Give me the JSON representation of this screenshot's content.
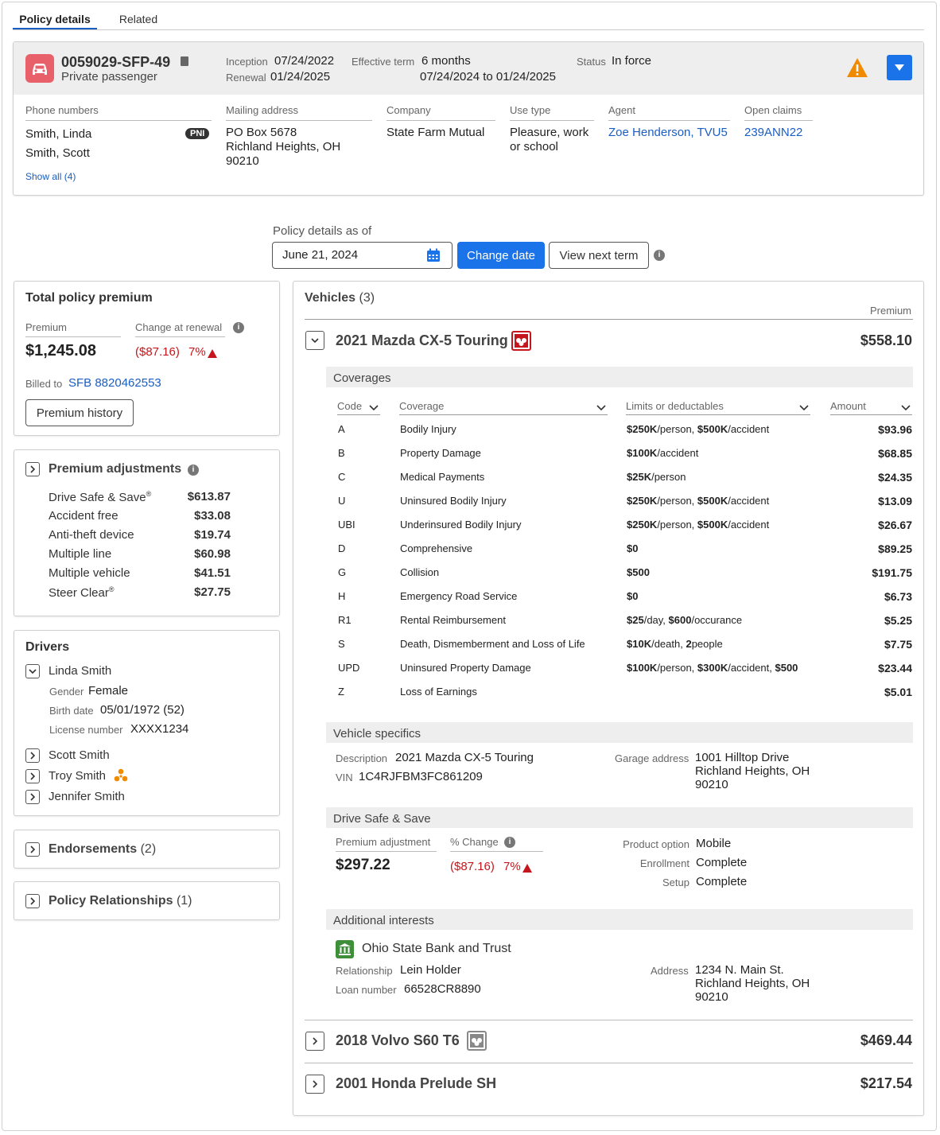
{
  "tabs": [
    {
      "label": "Policy details",
      "active": true
    },
    {
      "label": "Related",
      "active": false
    }
  ],
  "policy": {
    "number": "0059029-SFP-49",
    "type": "Private passenger",
    "inception_label": "Inception",
    "inception": "07/24/2022",
    "renewal_label": "Renewal",
    "renewal": "01/24/2025",
    "term_label": "Effective term",
    "term": "6 months",
    "term_range": "07/24/2024 to 01/24/2025",
    "status_label": "Status",
    "status": "In force"
  },
  "contacts": {
    "phone_label": "Phone numbers",
    "names": [
      "Smith, Linda",
      "Smith, Scott"
    ],
    "pni": "PNI",
    "show_all": "Show all (4)",
    "mail_label": "Mailing address",
    "mail_lines": [
      "PO Box 5678",
      "Richland Heights, OH",
      "90210"
    ],
    "company_label": "Company",
    "company": "State Farm Mutual",
    "use_label": "Use type",
    "use_lines": [
      "Pleasure, work",
      "or school"
    ],
    "agent_label": "Agent",
    "agent": "Zoe Henderson, TVU5",
    "claims_label": "Open claims",
    "claims": "239ANN22"
  },
  "asof": {
    "label": "Policy details as of",
    "date": "June 21, 2024",
    "change_btn": "Change date",
    "next_btn": "View next term"
  },
  "premium": {
    "title": "Total policy premium",
    "premium_label": "Premium",
    "premium": "$1,245.08",
    "change_label": "Change at renewal",
    "change": "($87.16)",
    "pct": "7%",
    "billed_label": "Billed to",
    "billed": "SFB 8820462553",
    "history_btn": "Premium history"
  },
  "adjust": {
    "title": "Premium adjustments",
    "items": [
      {
        "n": "Drive Safe & Save",
        "sup": "®",
        "v": "$613.87"
      },
      {
        "n": "Accident free",
        "sup": "",
        "v": "$33.08"
      },
      {
        "n": "Anti-theft device",
        "sup": "",
        "v": "$19.74"
      },
      {
        "n": "Multiple line",
        "sup": "",
        "v": "$60.98"
      },
      {
        "n": "Multiple vehicle",
        "sup": "",
        "v": "$41.51"
      },
      {
        "n": "Steer Clear",
        "sup": "®",
        "v": "$27.75"
      }
    ]
  },
  "drivers": {
    "title": "Drivers",
    "main": "Linda Smith",
    "gender_label": "Gender",
    "gender": "Female",
    "birth_label": "Birth date",
    "birth": "05/01/1972 (52)",
    "license_label": "License number",
    "license": "XXXX1234",
    "others": [
      "Scott Smith",
      "Troy Smith",
      "Jennifer Smith"
    ]
  },
  "endorsements": {
    "label": "Endorsements",
    "count": "(2)"
  },
  "relationships": {
    "label": "Policy Relationships",
    "count": "(1)"
  },
  "vehicles": {
    "title": "Vehicles",
    "count": "(3)",
    "premium_col": "Premium",
    "v1": {
      "name": "2021 Mazda CX-5 Touring",
      "premium": "$558.10"
    },
    "v2": {
      "name": "2018 Volvo S60 T6",
      "premium": "$469.44"
    },
    "v3": {
      "name": "2001 Honda Prelude SH",
      "premium": "$217.54"
    }
  },
  "coverages": {
    "title": "Coverages",
    "headers": [
      "Code",
      "Coverage",
      "Limits or deductables",
      "Amount"
    ],
    "rows": [
      {
        "code": "A",
        "cov": "Bodily Injury",
        "lim": [
          [
            "$250K",
            "/person, "
          ],
          [
            "$500K",
            "/accident"
          ]
        ],
        "amt": "$93.96"
      },
      {
        "code": "B",
        "cov": "Property Damage",
        "lim": [
          [
            "$100K",
            "/accident"
          ]
        ],
        "amt": "$68.85"
      },
      {
        "code": "C",
        "cov": "Medical Payments",
        "lim": [
          [
            "$25K",
            "/person"
          ]
        ],
        "amt": "$24.35"
      },
      {
        "code": "U",
        "cov": "Uninsured Bodily Injury",
        "lim": [
          [
            "$250K",
            "/person, "
          ],
          [
            "$500K",
            "/accident"
          ]
        ],
        "amt": "$13.09"
      },
      {
        "code": "UBI",
        "cov": "Underinsured Bodily Injury",
        "lim": [
          [
            "$250K",
            "/person, "
          ],
          [
            "$500K",
            "/accident"
          ]
        ],
        "amt": "$26.67"
      },
      {
        "code": "D",
        "cov": "Comprehensive",
        "lim": [
          [
            "$0",
            ""
          ]
        ],
        "amt": "$89.25"
      },
      {
        "code": "G",
        "cov": "Collision",
        "lim": [
          [
            "$500",
            ""
          ]
        ],
        "amt": "$191.75"
      },
      {
        "code": "H",
        "cov": "Emergency Road Service",
        "lim": [
          [
            "$0",
            ""
          ]
        ],
        "amt": "$6.73"
      },
      {
        "code": "R1",
        "cov": "Rental Reimbursement",
        "lim": [
          [
            "$25",
            "/day, "
          ],
          [
            "$600",
            "/occurance"
          ]
        ],
        "amt": "$5.25"
      },
      {
        "code": "S",
        "cov": "Death, Dismemberment and Loss of Life",
        "lim": [
          [
            "$10K",
            "/death, "
          ],
          [
            "2",
            "people"
          ]
        ],
        "amt": "$7.75"
      },
      {
        "code": "UPD",
        "cov": "Uninsured Property Damage",
        "lim": [
          [
            "$100K",
            "/person, "
          ],
          [
            "$300K",
            "/accident, "
          ],
          [
            "$500",
            ""
          ]
        ],
        "amt": "$23.44"
      },
      {
        "code": "Z",
        "cov": "Loss of Earnings",
        "lim": [],
        "amt": "$5.01"
      }
    ]
  },
  "specifics": {
    "title": "Vehicle specifics",
    "desc_label": "Description",
    "desc": "2021 Mazda CX-5 Touring",
    "vin_label": "VIN",
    "vin": "1C4RJFBM3FC861209",
    "garage_label": "Garage address",
    "garage_lines": [
      "1001 Hilltop Drive",
      "Richland Heights, OH",
      "90210"
    ]
  },
  "dss": {
    "title": "Drive Safe & Save",
    "adj_label": "Premium adjustment",
    "adj": "$297.22",
    "pct_label": "% Change",
    "change": "($87.16)",
    "pct": "7%",
    "product_label": "Product option",
    "product": "Mobile",
    "enroll_label": "Enrollment",
    "enroll": "Complete",
    "setup_label": "Setup",
    "setup": "Complete"
  },
  "interests": {
    "title": "Additional interests",
    "bank": "Ohio State Bank and Trust",
    "rel_label": "Relationship",
    "rel": "Lein Holder",
    "loan_label": "Loan number",
    "loan": "66528CR8890",
    "addr_label": "Address",
    "addr_lines": [
      "1234 N. Main St.",
      "Richland Heights, OH",
      "90210"
    ]
  }
}
